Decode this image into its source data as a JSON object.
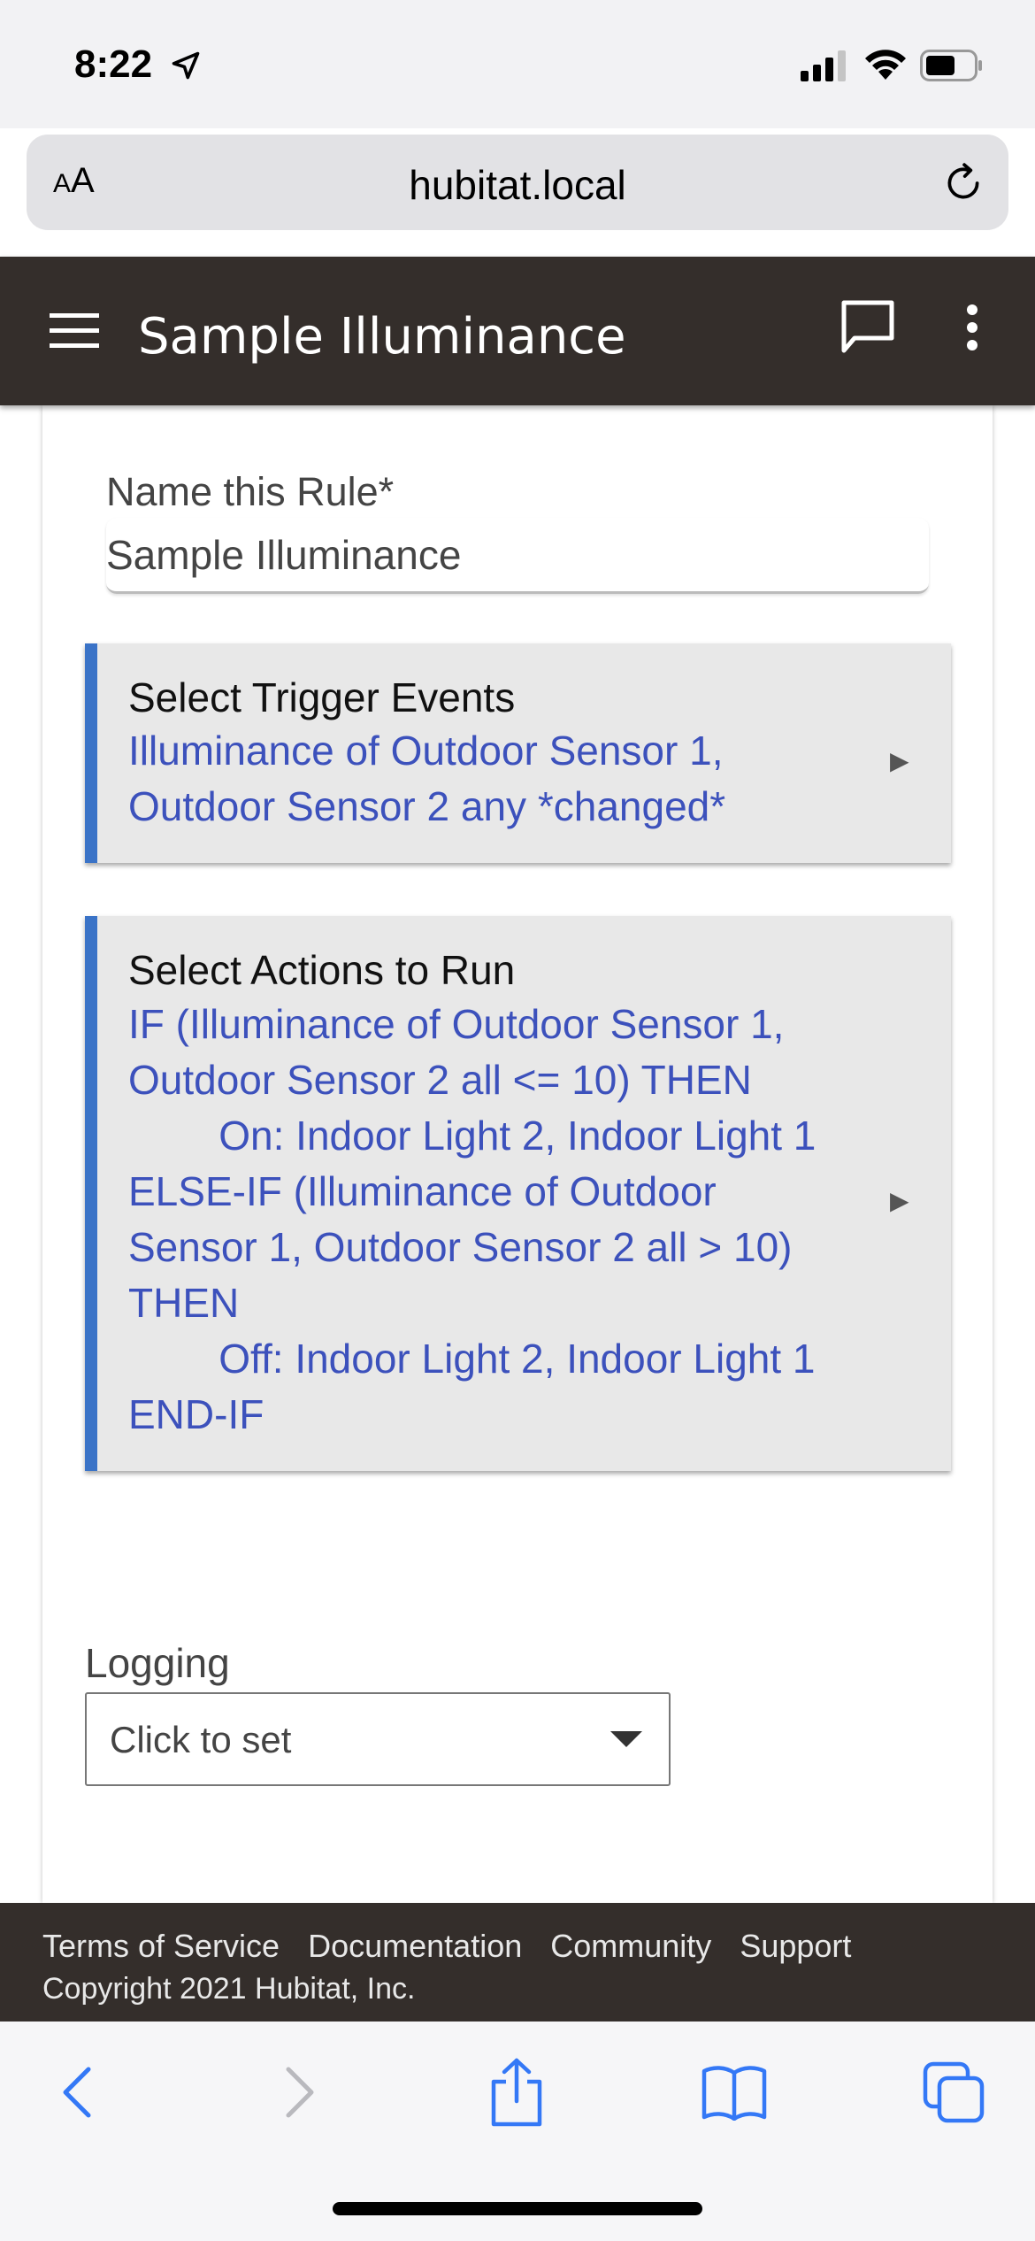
{
  "status_bar": {
    "time": "8:22"
  },
  "browser": {
    "text_size_label_small": "A",
    "text_size_label_large": "A",
    "url": "hubitat.local"
  },
  "header": {
    "title": "Sample Illuminance"
  },
  "form": {
    "rule_name_label": "Name this Rule*",
    "rule_name_value": "Sample Illuminance",
    "trigger": {
      "title": "Select Trigger Events",
      "summary": "Illuminance of Outdoor Sensor 1,\nOutdoor Sensor 2 any *changed*"
    },
    "actions": {
      "title": "Select Actions to Run",
      "summary": "IF (Illuminance of Outdoor Sensor 1,\nOutdoor Sensor 2 all <= 10) THEN\n        On: Indoor Light 2, Indoor Light 1\nELSE-IF (Illuminance of Outdoor\nSensor 1, Outdoor Sensor 2 all > 10)\nTHEN\n        Off: Indoor Light 2, Indoor Light 1\nEND-IF"
    },
    "logging_label": "Logging",
    "logging_value": "Click to set"
  },
  "footer": {
    "links": [
      "Terms of Service",
      "Documentation",
      "Community",
      "Support"
    ],
    "copyright": "Copyright 2021 Hubitat, Inc."
  },
  "colors": {
    "header_bg": "#342e2b",
    "accent_blue": "#3a73c7",
    "summary_text": "#3c51bc",
    "block_bg": "#e8e8e8",
    "ios_blue": "#3478f6"
  },
  "icons": {
    "location": "location-arrow-icon",
    "signal": "cellular-signal-icon",
    "wifi": "wifi-icon",
    "battery": "battery-icon",
    "reload": "reload-icon",
    "menu": "hamburger-menu-icon",
    "chat": "chat-bubble-icon",
    "more": "more-vertical-icon",
    "expand": "triangle-right-icon",
    "dropdown": "triangle-down-icon",
    "back": "chevron-left-icon",
    "forward": "chevron-right-icon",
    "share": "share-icon",
    "bookmarks": "book-icon",
    "tabs": "tabs-icon"
  }
}
